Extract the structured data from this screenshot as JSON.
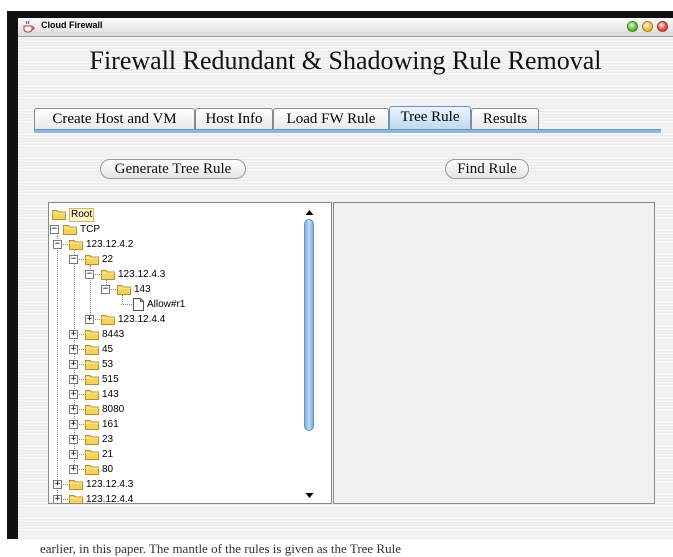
{
  "window": {
    "title": "Cloud Firewall",
    "heading": "Firewall Redundant & Shadowing Rule Removal",
    "traffic_lights": [
      "#55c02a",
      "#f2c12e",
      "#e8473a"
    ]
  },
  "tabs": [
    {
      "label": "Create Host and VM",
      "selected": false
    },
    {
      "label": "Host Info",
      "selected": false
    },
    {
      "label": "Load FW Rule",
      "selected": false
    },
    {
      "label": "Tree Rule",
      "selected": true
    },
    {
      "label": "Results",
      "selected": false
    }
  ],
  "buttons": {
    "generate": "Generate Tree Rule",
    "find": "Find Rule"
  },
  "tree": [
    {
      "label": "Root",
      "depth": 0,
      "state": "none",
      "selected": true
    },
    {
      "label": "TCP",
      "depth": 0,
      "state": "expanded"
    },
    {
      "label": "123.12.4.2",
      "depth": 1,
      "state": "expanded"
    },
    {
      "label": "22",
      "depth": 2,
      "state": "expanded"
    },
    {
      "label": "123.12.4.3",
      "depth": 3,
      "state": "expanded"
    },
    {
      "label": "143",
      "depth": 4,
      "state": "expanded"
    },
    {
      "label": "Allow#r1",
      "depth": 5,
      "state": "leaf"
    },
    {
      "label": "123.12.4.4",
      "depth": 3,
      "state": "collapsed"
    },
    {
      "label": "8443",
      "depth": 2,
      "state": "collapsed"
    },
    {
      "label": "45",
      "depth": 2,
      "state": "collapsed"
    },
    {
      "label": "53",
      "depth": 2,
      "state": "collapsed"
    },
    {
      "label": "515",
      "depth": 2,
      "state": "collapsed"
    },
    {
      "label": "143",
      "depth": 2,
      "state": "collapsed"
    },
    {
      "label": "8080",
      "depth": 2,
      "state": "collapsed"
    },
    {
      "label": "161",
      "depth": 2,
      "state": "collapsed"
    },
    {
      "label": "23",
      "depth": 2,
      "state": "collapsed"
    },
    {
      "label": "21",
      "depth": 2,
      "state": "collapsed"
    },
    {
      "label": "80",
      "depth": 2,
      "state": "collapsed"
    },
    {
      "label": "123.12.4.3",
      "depth": 1,
      "state": "collapsed"
    },
    {
      "label": "123.12.4.4",
      "depth": 1,
      "state": "collapsed"
    }
  ],
  "footer_text": "earlier, in this paper. The mantle of the rules is given as the Tree Rule"
}
